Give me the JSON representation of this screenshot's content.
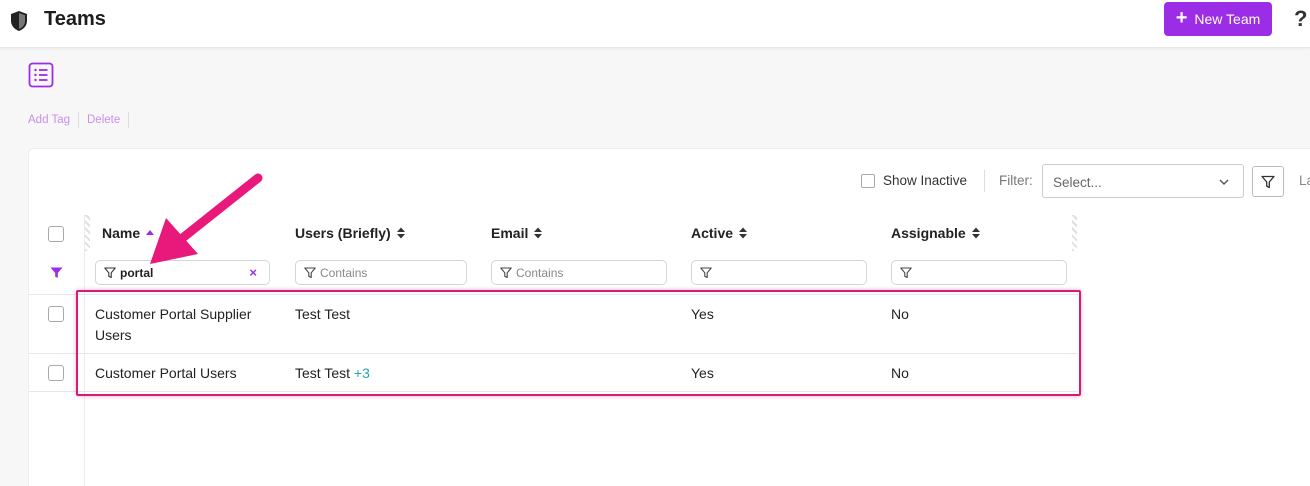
{
  "header": {
    "title": "Teams",
    "new_button_label": "New Team",
    "help_glyph": "?"
  },
  "actions": [
    "Add Tag",
    "Delete"
  ],
  "toolbar": {
    "show_inactive_label": "Show Inactive",
    "filter_label": "Filter:",
    "filter_placeholder": "Select...",
    "cut_text": "La"
  },
  "table": {
    "columns": [
      {
        "label": "Name",
        "sort": "asc",
        "filter_value": "portal",
        "filter_placeholder": ""
      },
      {
        "label": "Users (Briefly)",
        "sort": "none",
        "filter_value": "",
        "filter_placeholder": "Contains"
      },
      {
        "label": "Email",
        "sort": "none",
        "filter_value": "",
        "filter_placeholder": "Contains"
      },
      {
        "label": "Active",
        "sort": "none",
        "filter_value": "",
        "filter_placeholder": ""
      },
      {
        "label": "Assignable",
        "sort": "none",
        "filter_value": "",
        "filter_placeholder": ""
      }
    ],
    "rows": [
      {
        "name_line1": "Customer Portal Supplier",
        "name_line2": "Users",
        "users": "Test Test",
        "users_extra": "",
        "email": "",
        "active": "Yes",
        "assignable": "No"
      },
      {
        "name_line1": "Customer Portal Users",
        "name_line2": "",
        "users": "Test Test",
        "users_extra": "+3",
        "email": "",
        "active": "Yes",
        "assignable": "No"
      }
    ]
  },
  "colors": {
    "accent": "#9b2de6",
    "highlight": "#d81b75",
    "count_badge": "#27a3b0"
  }
}
